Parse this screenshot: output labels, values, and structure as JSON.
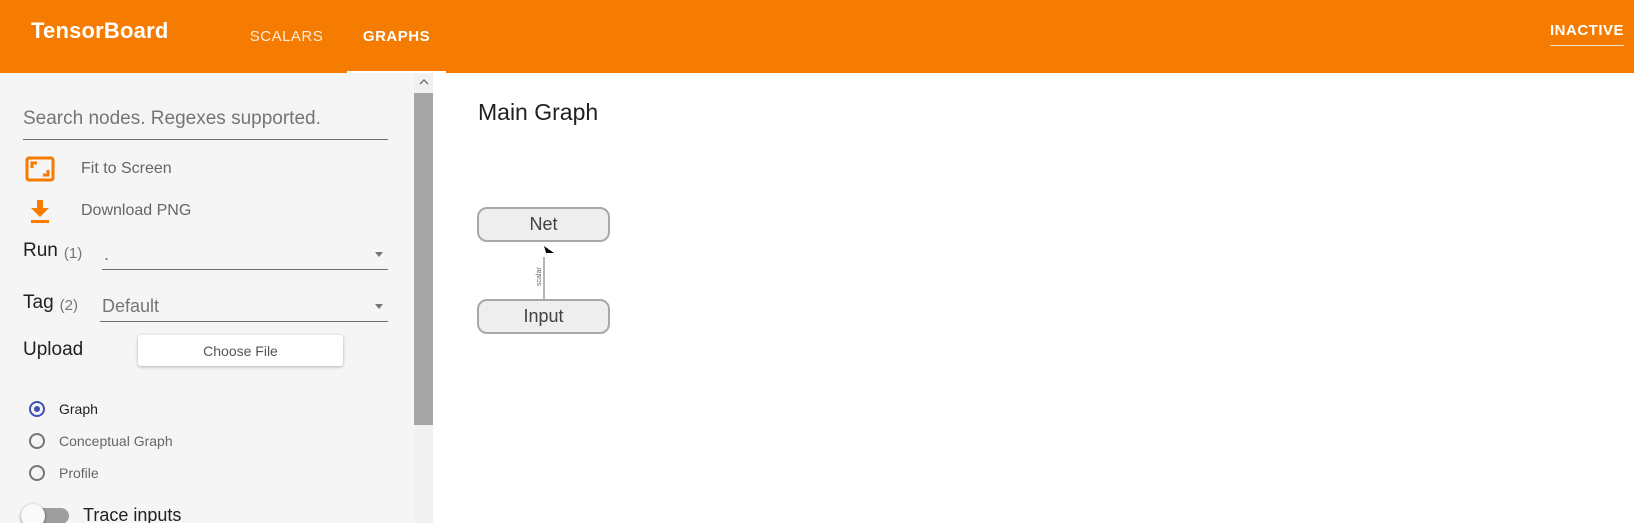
{
  "app": {
    "title": "TensorBoard"
  },
  "header": {
    "tabs": [
      {
        "label": "SCALARS",
        "active": false
      },
      {
        "label": "GRAPHS",
        "active": true
      }
    ],
    "status": "INACTIVE"
  },
  "sidebar": {
    "search": {
      "placeholder": "Search nodes. Regexes supported.",
      "value": ""
    },
    "fit_to_screen": {
      "label": "Fit to Screen",
      "icon": "fit-screen-icon"
    },
    "download_png": {
      "label": "Download PNG",
      "icon": "download-icon"
    },
    "run": {
      "label": "Run",
      "count": "(1)",
      "value": "."
    },
    "tag": {
      "label": "Tag",
      "count": "(2)",
      "value": "Default"
    },
    "upload": {
      "label": "Upload",
      "button": "Choose File"
    },
    "graph_types": [
      {
        "label": "Graph",
        "checked": true
      },
      {
        "label": "Conceptual Graph",
        "checked": false
      },
      {
        "label": "Profile",
        "checked": false
      }
    ],
    "trace_inputs": {
      "label": "Trace inputs",
      "enabled": false
    }
  },
  "main": {
    "title": "Main Graph",
    "nodes": [
      {
        "label": "Net"
      },
      {
        "label": "Input"
      }
    ],
    "edge": {
      "label": "scalar",
      "from": "Input",
      "to": "Net"
    }
  },
  "colors": {
    "header": "#f57c00",
    "accent_icon": "#f57c00",
    "radio_checked": "#3f51b5",
    "node_fill": "#eeeeee",
    "node_border": "#a8a8a8"
  }
}
